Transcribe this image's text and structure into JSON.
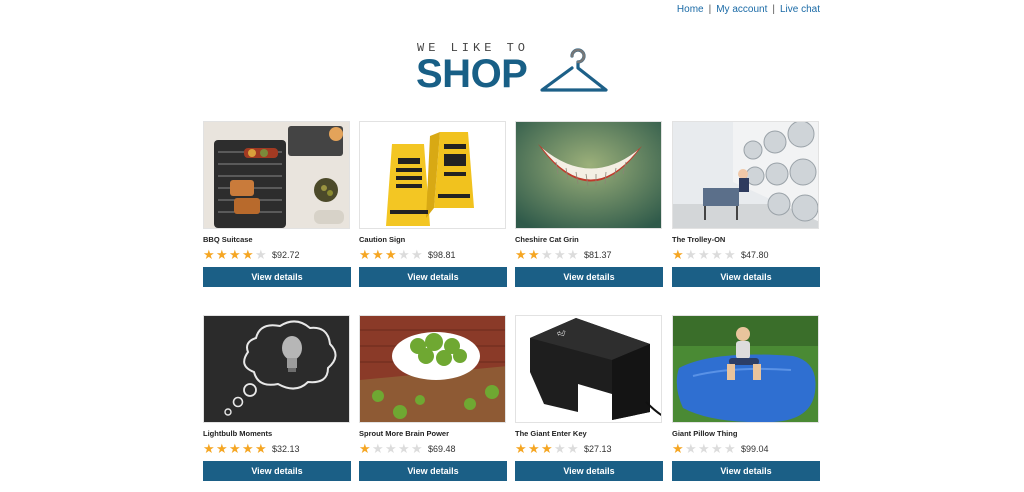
{
  "nav": {
    "links": [
      {
        "label": "Home"
      },
      {
        "label": "My account"
      },
      {
        "label": "Live chat"
      }
    ],
    "separator": "|"
  },
  "logo": {
    "tagline": "WE LIKE TO",
    "brand": "SHOP"
  },
  "colors": {
    "brand": "#185f86",
    "button": "#1b5f86",
    "star_on": "#f5a623",
    "star_off": "#dcdcdc",
    "link": "#1a6aa6"
  },
  "products": [
    {
      "name": "BBQ Suitcase",
      "rating": 4,
      "price": "$92.72",
      "button": "View details",
      "image": "bbq-grill"
    },
    {
      "name": "Caution Sign",
      "rating": 3,
      "price": "$98.81",
      "button": "View details",
      "image": "caution-signs"
    },
    {
      "name": "Cheshire Cat Grin",
      "rating": 2,
      "price": "$81.37",
      "button": "View details",
      "image": "cat-grin"
    },
    {
      "name": "The Trolley-ON",
      "rating": 1,
      "price": "$47.80",
      "button": "View details",
      "image": "laundromat"
    },
    {
      "name": "Lightbulb Moments",
      "rating": 5,
      "price": "$32.13",
      "button": "View details",
      "image": "lightbulb-chalkboard"
    },
    {
      "name": "Sprout More Brain Power",
      "rating": 1,
      "price": "$69.48",
      "button": "View details",
      "image": "sprouts-bowl"
    },
    {
      "name": "The Giant Enter Key",
      "rating": 3,
      "price": "$27.13",
      "button": "View details",
      "image": "enter-key"
    },
    {
      "name": "Giant Pillow Thing",
      "rating": 1,
      "price": "$99.04",
      "button": "View details",
      "image": "pillow-girl"
    }
  ]
}
